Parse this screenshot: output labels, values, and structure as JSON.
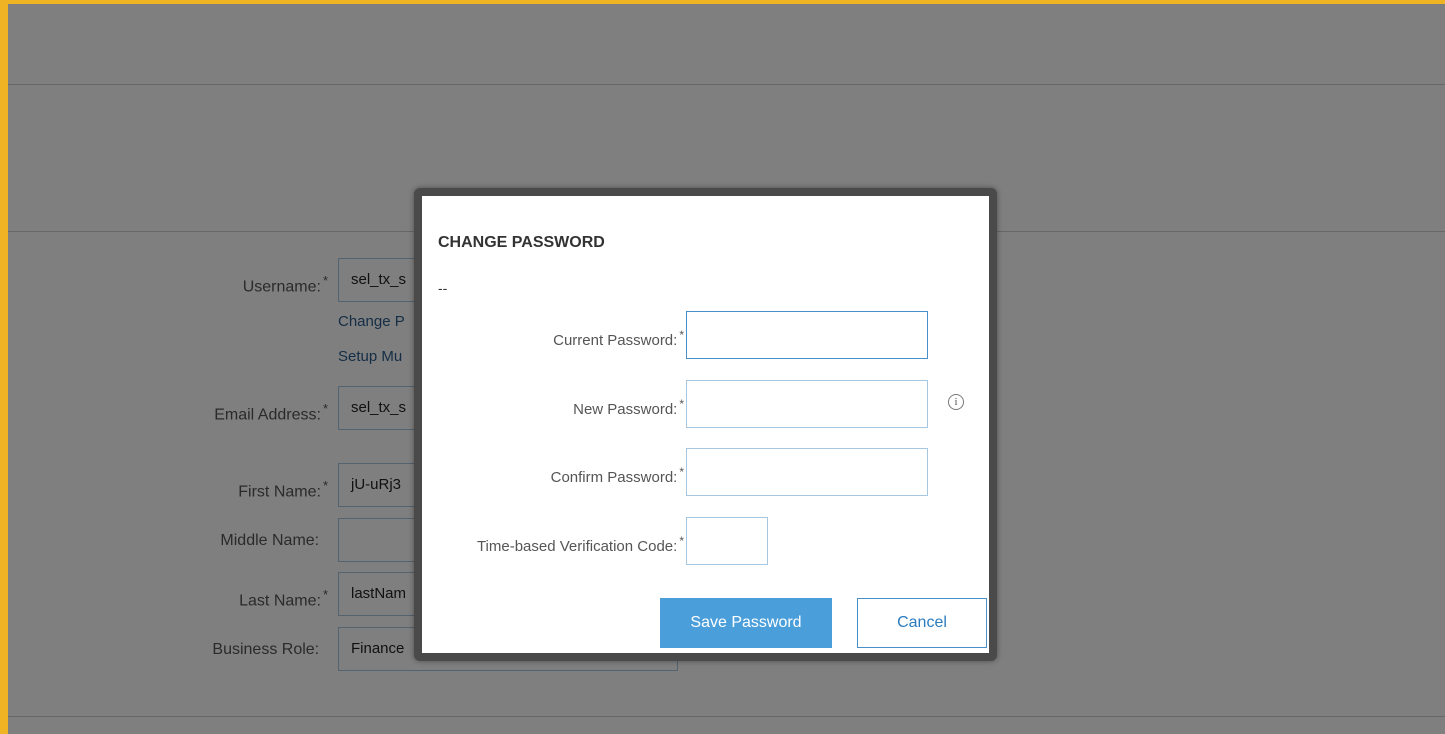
{
  "background_form": {
    "username": {
      "label": "Username:",
      "required": "*",
      "value": "sel_tx_s"
    },
    "links": {
      "change_password": "Change P",
      "setup_mfa": "Setup Mu"
    },
    "email": {
      "label": "Email Address:",
      "required": "*",
      "value": "sel_tx_s"
    },
    "first_name": {
      "label": "First Name:",
      "required": "*",
      "value": "jU-uRj3"
    },
    "middle_name": {
      "label": "Middle Name:",
      "value": ""
    },
    "last_name": {
      "label": "Last Name:",
      "required": "*",
      "value": "lastNam"
    },
    "business_role": {
      "label": "Business Role:",
      "value": "Finance"
    }
  },
  "modal": {
    "title": "CHANGE PASSWORD",
    "subtitle": "--",
    "fields": {
      "current_password": {
        "label": "Current Password:",
        "required": "*",
        "value": ""
      },
      "new_password": {
        "label": "New Password:",
        "required": "*",
        "value": "",
        "info_icon": "info-icon",
        "info_glyph": "i"
      },
      "confirm_password": {
        "label": "Confirm Password:",
        "required": "*",
        "value": ""
      },
      "verification_code": {
        "label": "Time-based Verification Code:",
        "required": "*",
        "value": ""
      }
    },
    "save_label": "Save Password",
    "cancel_label": "Cancel"
  },
  "colors": {
    "frame_border": "#f0b323",
    "primary_button": "#4a9fdb",
    "link": "#2b5d8c",
    "input_border": "#a7c6e0"
  }
}
